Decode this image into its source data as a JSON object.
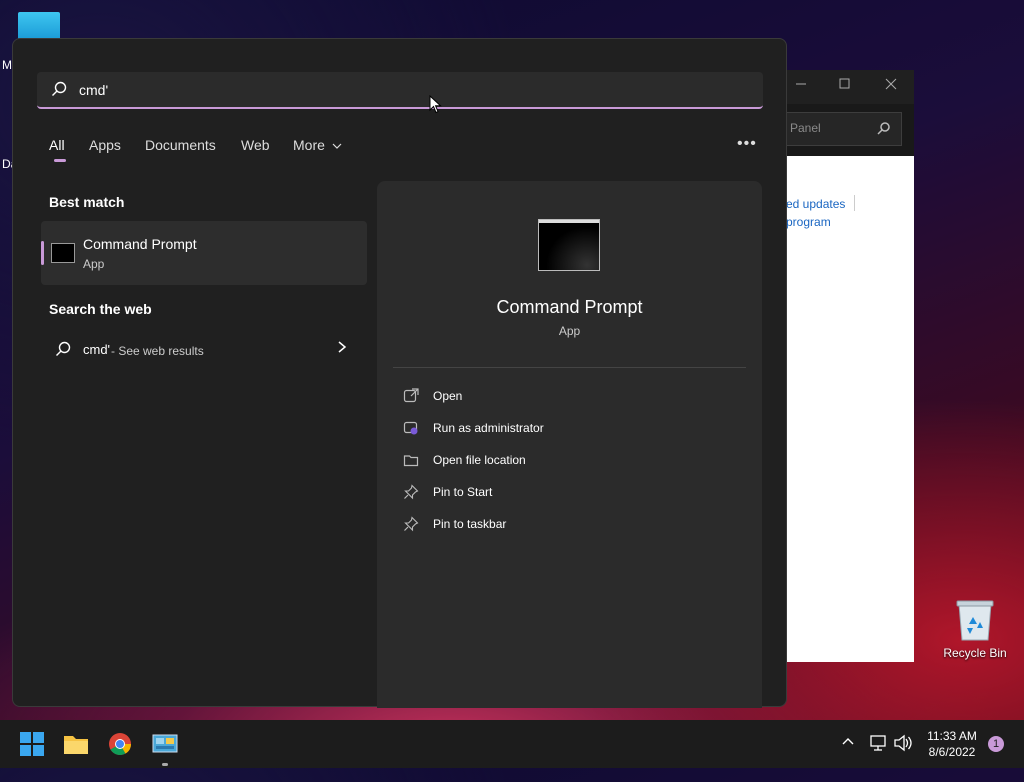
{
  "desktop": {
    "frag_top": "M",
    "frag_mid": "Da",
    "recycle_bin": "Recycle Bin"
  },
  "background_window": {
    "search_placeholder": "Panel",
    "link1": "ed updates",
    "link2": "program"
  },
  "search": {
    "query": "cmd'",
    "tabs": [
      "All",
      "Apps",
      "Documents",
      "Web",
      "More"
    ],
    "best_match_title": "Best match",
    "best_match": {
      "title": "Command Prompt",
      "subtitle": "App"
    },
    "search_web_title": "Search the web",
    "web_query": "cmd'",
    "web_suffix": "- See web results"
  },
  "detail": {
    "title": "Command Prompt",
    "subtitle": "App",
    "actions": [
      {
        "label": "Open",
        "icon": "open-icon"
      },
      {
        "label": "Run as administrator",
        "icon": "shield-icon"
      },
      {
        "label": "Open file location",
        "icon": "folder-icon"
      },
      {
        "label": "Pin to Start",
        "icon": "pin-icon"
      },
      {
        "label": "Pin to taskbar",
        "icon": "pin-icon"
      }
    ]
  },
  "taskbar": {
    "time": "11:33 AM",
    "date": "8/6/2022",
    "notification_count": "1"
  },
  "colors": {
    "accent": "#c99ad8",
    "flyout_bg": "#202020",
    "panel_bg": "#2b2b2b",
    "taskbar_bg": "#1c1c1c"
  }
}
